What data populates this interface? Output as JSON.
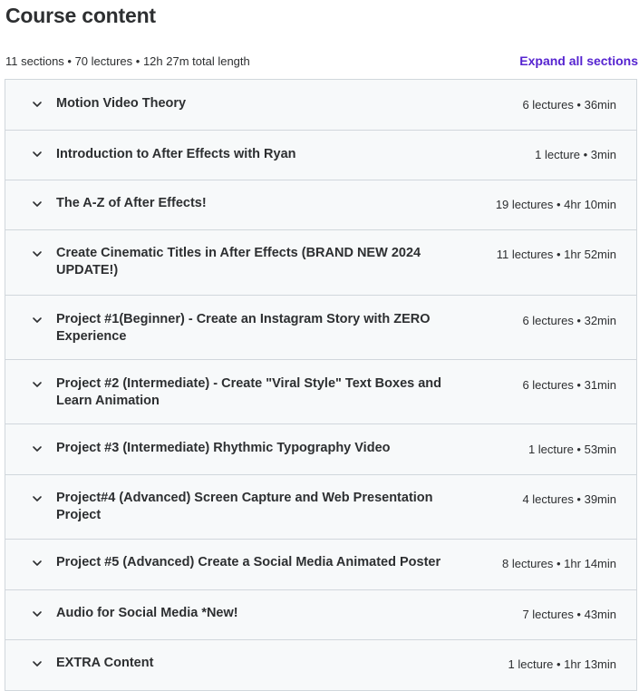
{
  "header": {
    "title": "Course content",
    "summary": "11 sections • 70 lectures • 12h 27m total length",
    "expand_label": "Expand all sections"
  },
  "sections": [
    {
      "title": "Motion Video Theory",
      "meta": "6 lectures • 36min"
    },
    {
      "title": "Introduction to After Effects with Ryan",
      "meta": "1 lecture • 3min"
    },
    {
      "title": "The A-Z of After Effects!",
      "meta": "19 lectures • 4hr 10min"
    },
    {
      "title": "Create Cinematic Titles in After Effects (BRAND NEW 2024 UPDATE!)",
      "meta": "11 lectures • 1hr 52min"
    },
    {
      "title": "Project #1(Beginner) - Create an Instagram Story with ZERO Experience",
      "meta": "6 lectures • 32min"
    },
    {
      "title": "Project #2 (Intermediate) - Create \"Viral Style\" Text Boxes and Learn Animation",
      "meta": "6 lectures • 31min"
    },
    {
      "title": "Project #3 (Intermediate) Rhythmic Typography Video",
      "meta": "1 lecture • 53min"
    },
    {
      "title": "Project#4 (Advanced) Screen Capture and Web Presentation Project",
      "meta": "4 lectures • 39min"
    },
    {
      "title": "Project #5 (Advanced) Create a Social Media Animated Poster",
      "meta": "8 lectures • 1hr 14min"
    },
    {
      "title": "Audio for Social Media *New!",
      "meta": "7 lectures • 43min"
    },
    {
      "title": "EXTRA Content",
      "meta": "1 lecture • 1hr 13min"
    }
  ],
  "icons": {
    "section_toggle": "chevron-down-icon"
  },
  "colors": {
    "accent": "#5624d0",
    "row_bg": "#f7f9fa",
    "border": "#d1d7dc",
    "text": "#2d2f31"
  }
}
